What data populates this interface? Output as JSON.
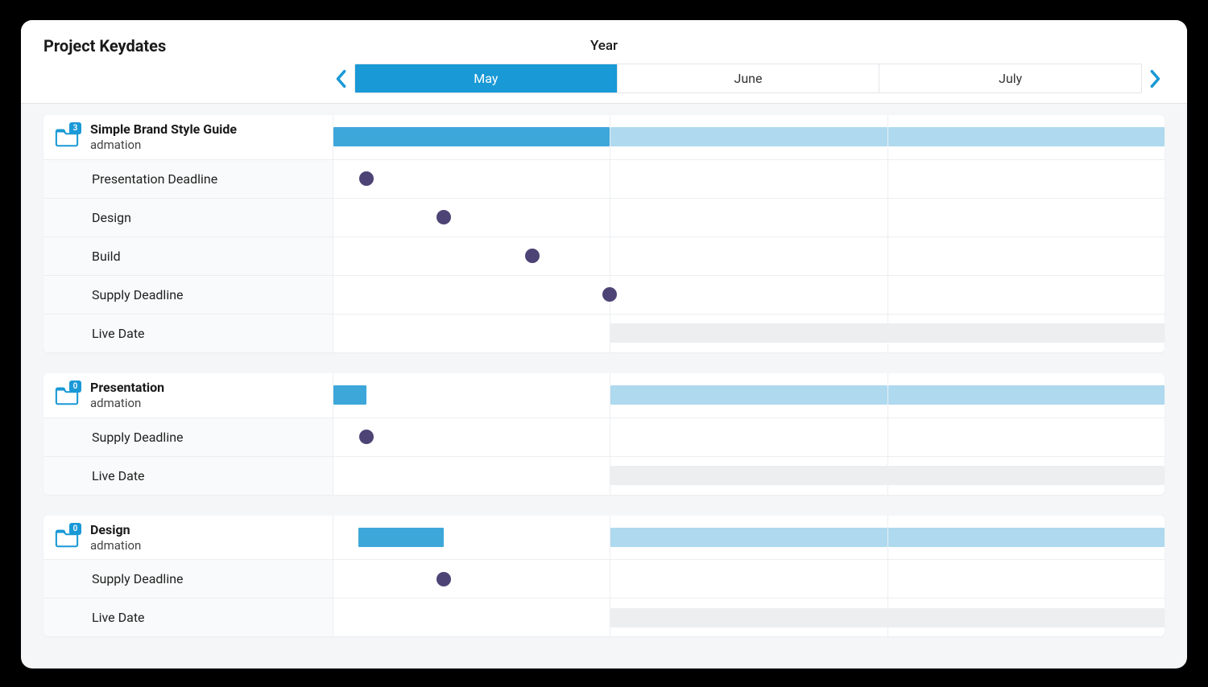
{
  "header": {
    "title": "Project Keydates",
    "year_label": "Year",
    "months": [
      {
        "label": "May",
        "active": true
      },
      {
        "label": "June",
        "active": false
      },
      {
        "label": "July",
        "active": false
      }
    ]
  },
  "colors": {
    "accent": "#1999d6",
    "bar_dark": "#3ea7da",
    "bar_light": "#aed9ef",
    "milestone_dot": "#4d4475",
    "placeholder": "#eceef0"
  },
  "chart_data": {
    "type": "bar",
    "title": "Project Keydates",
    "xlabel": "Year",
    "categories": [
      "May",
      "June",
      "July"
    ],
    "series": [
      {
        "name": "Simple Brand Style Guide",
        "subtitle": "admation",
        "badge": 3,
        "duration_bars": [
          {
            "month": "May",
            "start_pct": 0,
            "end_pct": 100,
            "style": "dark"
          },
          {
            "month": "June",
            "start_pct": 0,
            "end_pct": 100,
            "style": "light"
          },
          {
            "month": "July",
            "start_pct": 0,
            "end_pct": 100,
            "style": "light"
          }
        ],
        "milestones": [
          {
            "label": "Presentation Deadline",
            "month": "May",
            "pct": 12
          },
          {
            "label": "Design",
            "month": "May",
            "pct": 40
          },
          {
            "label": "Build",
            "month": "May",
            "pct": 72
          },
          {
            "label": "Supply Deadline",
            "month": "May",
            "pct": 100
          },
          {
            "label": "Live Date",
            "month": null,
            "pct": null,
            "placeholder_bars": [
              {
                "month": "June",
                "start_pct": 0,
                "end_pct": 100
              },
              {
                "month": "July",
                "start_pct": 0,
                "end_pct": 100
              }
            ]
          }
        ]
      },
      {
        "name": "Presentation",
        "subtitle": "admation",
        "badge": 0,
        "duration_bars": [
          {
            "month": "May",
            "start_pct": 0,
            "end_pct": 12,
            "style": "dark"
          },
          {
            "month": "June",
            "start_pct": 0,
            "end_pct": 100,
            "style": "light"
          },
          {
            "month": "July",
            "start_pct": 0,
            "end_pct": 100,
            "style": "light"
          }
        ],
        "milestones": [
          {
            "label": "Supply Deadline",
            "month": "May",
            "pct": 12
          },
          {
            "label": "Live Date",
            "month": null,
            "pct": null,
            "placeholder_bars": [
              {
                "month": "June",
                "start_pct": 0,
                "end_pct": 100
              },
              {
                "month": "July",
                "start_pct": 0,
                "end_pct": 100
              }
            ]
          }
        ]
      },
      {
        "name": "Design",
        "subtitle": "admation",
        "badge": 0,
        "duration_bars": [
          {
            "month": "May",
            "start_pct": 9,
            "end_pct": 40,
            "style": "dark"
          },
          {
            "month": "June",
            "start_pct": 0,
            "end_pct": 100,
            "style": "light"
          },
          {
            "month": "July",
            "start_pct": 0,
            "end_pct": 100,
            "style": "light"
          }
        ],
        "milestones": [
          {
            "label": "Supply Deadline",
            "month": "May",
            "pct": 40
          },
          {
            "label": "Live Date",
            "month": null,
            "pct": null,
            "placeholder_bars": [
              {
                "month": "June",
                "start_pct": 0,
                "end_pct": 100
              },
              {
                "month": "July",
                "start_pct": 0,
                "end_pct": 100
              }
            ]
          }
        ]
      }
    ]
  }
}
